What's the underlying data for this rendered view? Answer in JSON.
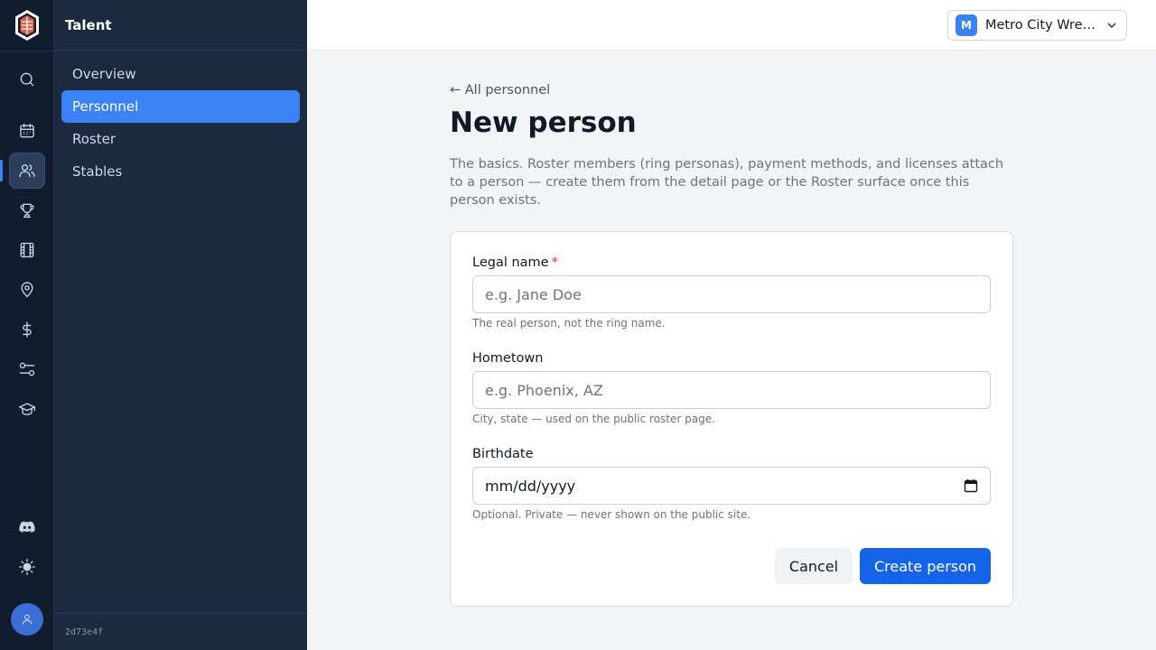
{
  "rail": {
    "items": [
      {
        "icon": "search-icon"
      },
      {
        "icon": "calendar-icon"
      },
      {
        "icon": "users-icon",
        "active": true
      },
      {
        "icon": "trophy-icon"
      },
      {
        "icon": "film-icon"
      },
      {
        "icon": "map-pin-icon"
      },
      {
        "icon": "dollar-icon"
      },
      {
        "icon": "sliders-icon"
      },
      {
        "icon": "graduation-cap-icon"
      },
      {
        "icon": "discord-icon"
      },
      {
        "icon": "sun-icon"
      }
    ],
    "avatar_icon": "user-icon"
  },
  "sidebar": {
    "title": "Talent",
    "items": [
      {
        "label": "Overview"
      },
      {
        "label": "Personnel",
        "active": true
      },
      {
        "label": "Roster"
      },
      {
        "label": "Stables"
      }
    ],
    "build_hash": "2d73e4f"
  },
  "topbar": {
    "org_initial": "M",
    "org_name": "Metro City Wrestling",
    "org_color": "#3b82f6"
  },
  "page": {
    "back_link": "← All personnel",
    "title": "New person",
    "description": "The basics. Roster members (ring personas), payment methods, and licenses attach to a person — create them from the detail page or the Roster surface once this person exists."
  },
  "form": {
    "legal_name": {
      "label": "Legal name",
      "required_mark": "*",
      "placeholder": "e.g. Jane Doe",
      "value": "",
      "hint": "The real person, not the ring name."
    },
    "hometown": {
      "label": "Hometown",
      "placeholder": "e.g. Phoenix, AZ",
      "value": "",
      "hint": "City, state — used on the public roster page."
    },
    "birthdate": {
      "label": "Birthdate",
      "placeholder": "mm/dd/yyyy",
      "hint": "Optional. Private — never shown on the public site."
    },
    "cancel_label": "Cancel",
    "submit_label": "Create person"
  },
  "colors": {
    "accent": "#3b82f6",
    "primary_button": "#1563e8",
    "rail_bg": "#111c2e",
    "sidebar_bg": "#1b2a41",
    "required": "#dc2626"
  }
}
